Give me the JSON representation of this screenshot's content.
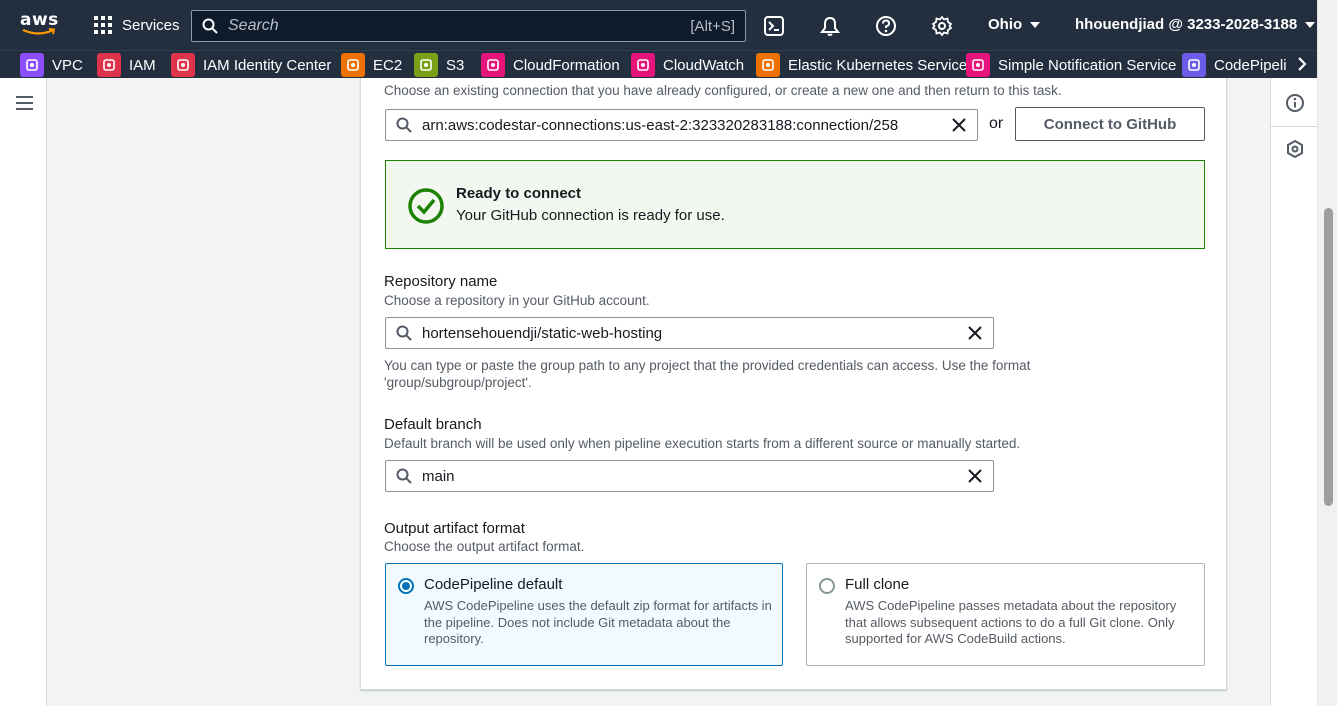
{
  "topnav": {
    "logo_text": "aws",
    "services_label": "Services",
    "search_placeholder": "Search",
    "search_shortcut": "[Alt+S]",
    "region": "Ohio",
    "account": "hhouendjiad @ 3233-2028-3188"
  },
  "favorites": [
    {
      "label": "VPC",
      "icon": "vpc-icon",
      "color": "#8c4fff"
    },
    {
      "label": "IAM",
      "icon": "iam-icon",
      "color": "#dd344c"
    },
    {
      "label": "IAM Identity Center",
      "icon": "identity-center-icon",
      "color": "#dd344c"
    },
    {
      "label": "EC2",
      "icon": "ec2-icon",
      "color": "#ed7100"
    },
    {
      "label": "S3",
      "icon": "s3-icon",
      "color": "#7aa116"
    },
    {
      "label": "CloudFormation",
      "icon": "cloudformation-icon",
      "color": "#e7157b"
    },
    {
      "label": "CloudWatch",
      "icon": "cloudwatch-icon",
      "color": "#e7157b"
    },
    {
      "label": "Elastic Kubernetes Service",
      "icon": "eks-icon",
      "color": "#ed7100"
    },
    {
      "label": "Simple Notification Service",
      "icon": "sns-icon",
      "color": "#e7157b"
    },
    {
      "label": "CodePipeli",
      "icon": "codepipeline-icon",
      "color": "#6c5ce7"
    }
  ],
  "connection": {
    "help_text": "Choose an existing connection that you have already configured, or create a new one and then return to this task.",
    "value": "arn:aws:codestar-connections:us-east-2:323320283188:connection/258",
    "or_text": "or",
    "connect_button": "Connect to GitHub"
  },
  "alert": {
    "title": "Ready to connect",
    "message": "Your GitHub connection is ready for use.",
    "color": "#1d8102"
  },
  "repository": {
    "label": "Repository name",
    "description": "Choose a repository in your GitHub account.",
    "value": "hortensehouendji/static-web-hosting",
    "hint_line1": "You can type or paste the group path to any project that the provided credentials can access. Use the format",
    "hint_line2": "'group/subgroup/project'."
  },
  "branch": {
    "label": "Default branch",
    "description": "Default branch will be used only when pipeline execution starts from a different source or manually started.",
    "value": "main"
  },
  "artifact": {
    "label": "Output artifact format",
    "description": "Choose the output artifact format.",
    "options": [
      {
        "title": "CodePipeline default",
        "description": "AWS CodePipeline uses the default zip format for artifacts in the pipeline. Does not include Git metadata about the repository.",
        "selected": true
      },
      {
        "title": "Full clone",
        "description": "AWS CodePipeline passes metadata about the repository that allows subsequent actions to do a full Git clone. Only supported for AWS CodeBuild actions.",
        "selected": false
      }
    ]
  },
  "colors": {
    "nav_bg": "#232f3e",
    "accent": "#0073bb",
    "success": "#1d8102"
  }
}
